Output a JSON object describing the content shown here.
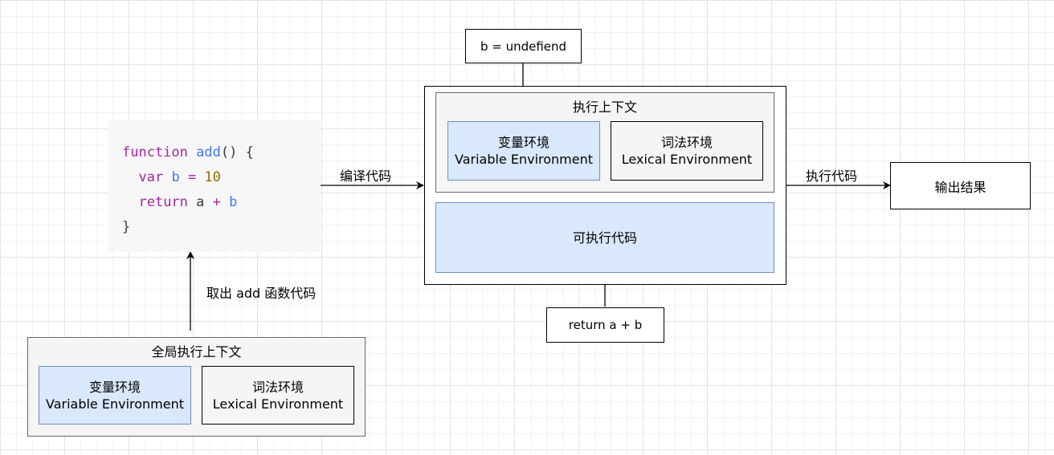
{
  "code": {
    "lines": [
      [
        {
          "t": "function",
          "c": "kw"
        },
        {
          "t": " ",
          "c": ""
        },
        {
          "t": "add",
          "c": "fn"
        },
        {
          "t": "() {",
          "c": ""
        }
      ],
      [
        {
          "t": "  ",
          "c": ""
        },
        {
          "t": "var",
          "c": "kw"
        },
        {
          "t": " ",
          "c": ""
        },
        {
          "t": "b",
          "c": "var"
        },
        {
          "t": " = ",
          "c": "op"
        },
        {
          "t": "10",
          "c": "num"
        }
      ],
      [
        {
          "t": "  ",
          "c": ""
        },
        {
          "t": "return",
          "c": "kw"
        },
        {
          "t": " a ",
          "c": ""
        },
        {
          "t": "+",
          "c": "op"
        },
        {
          "t": " ",
          "c": ""
        },
        {
          "t": "b",
          "c": "var"
        }
      ],
      [
        {
          "t": "}",
          "c": ""
        }
      ]
    ]
  },
  "labels": {
    "compile": "编译代码",
    "fetch": "取出 add 函数代码",
    "execute": "执行代码"
  },
  "exec_context": {
    "title": "执行上下文",
    "var_env_cn": "变量环境",
    "var_env_en": "Variable Environment",
    "lex_env_cn": "词法环境",
    "lex_env_en": "Lexical Environment",
    "executable": "可执行代码"
  },
  "b_value": "b = undefiend",
  "return_box": "return a + b",
  "output": "输出结果",
  "global_context": {
    "title": "全局执行上下文",
    "var_env_cn": "变量环境",
    "var_env_en": "Variable Environment",
    "lex_env_cn": "词法环境",
    "lex_env_en": "Lexical Environment"
  }
}
